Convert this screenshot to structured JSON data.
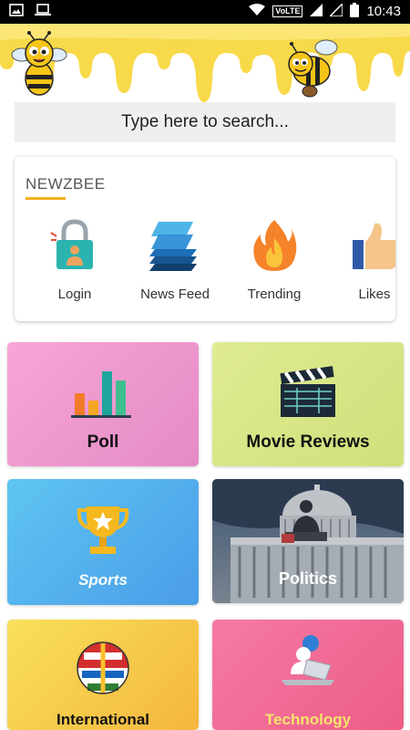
{
  "status_bar": {
    "time": "10:43",
    "network": "VoLTE"
  },
  "search": {
    "placeholder": "Type here to search..."
  },
  "section": {
    "title": "NEWZBEE",
    "items": [
      {
        "label": "Login",
        "icon": "lock-person-icon"
      },
      {
        "label": "News Feed",
        "icon": "stacked-layers-icon"
      },
      {
        "label": "Trending",
        "icon": "flame-icon"
      },
      {
        "label": "Likes",
        "icon": "thumbs-up-icon"
      }
    ]
  },
  "categories": [
    {
      "label": "Poll",
      "icon": "bar-chart-icon"
    },
    {
      "label": "Movie Reviews",
      "icon": "clapperboard-icon"
    },
    {
      "label": "Sports",
      "icon": "trophy-icon"
    },
    {
      "label": "Politics",
      "icon": "capitol-photo"
    },
    {
      "label": "International",
      "icon": "world-flags-globe-icon"
    },
    {
      "label": "Technology",
      "icon": "laptop-person-icon"
    }
  ],
  "colors": {
    "honey": "#f8d94a",
    "accent": "#f2b01e",
    "poll_gradient": [
      "#f7a6d6",
      "#e58ac6"
    ],
    "movie_gradient": [
      "#e0eb92",
      "#cfe07a"
    ],
    "sports_gradient": [
      "#5fc5f2",
      "#4a9de8"
    ],
    "international_gradient": [
      "#f8e05b",
      "#f5b63d"
    ],
    "technology_gradient": [
      "#f57aa5",
      "#ec5d86"
    ]
  }
}
